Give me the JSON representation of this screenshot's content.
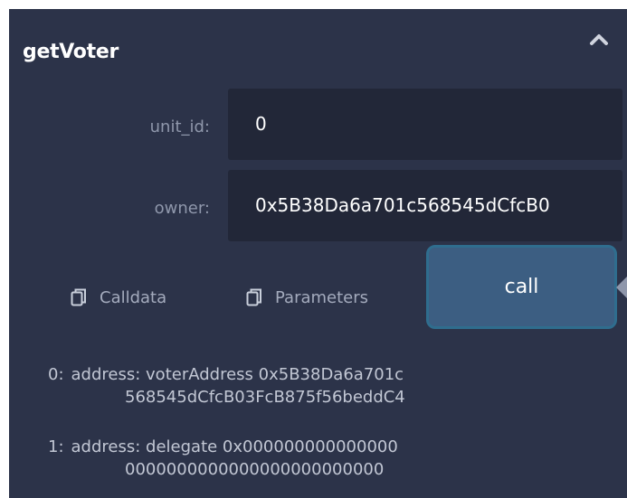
{
  "function": {
    "title": "getVoter"
  },
  "inputs": [
    {
      "label": "unit_id:",
      "value": "0"
    },
    {
      "label": "owner:",
      "value": "0x5B38Da6a701c568545dCfcB0"
    }
  ],
  "actions": {
    "calldata_label": "Calldata",
    "parameters_label": "Parameters",
    "call_label": "call"
  },
  "results": [
    {
      "index": "0:",
      "line1": "address: voterAddress 0x5B38Da6a701c",
      "line2": "568545dCfcB03FcB875f56beddC4"
    },
    {
      "index": "1:",
      "line1": "address: delegate 0x000000000000000",
      "line2": "0000000000000000000000000"
    }
  ],
  "colors": {
    "panel_bg": "#2c3349",
    "input_bg": "#222738",
    "call_button_bg": "#3c5e82",
    "call_button_border": "#2f6d8e",
    "label_text": "#8f97ab"
  },
  "icons": {
    "collapse": "chevron-up-icon",
    "copy": "copy-icon"
  }
}
